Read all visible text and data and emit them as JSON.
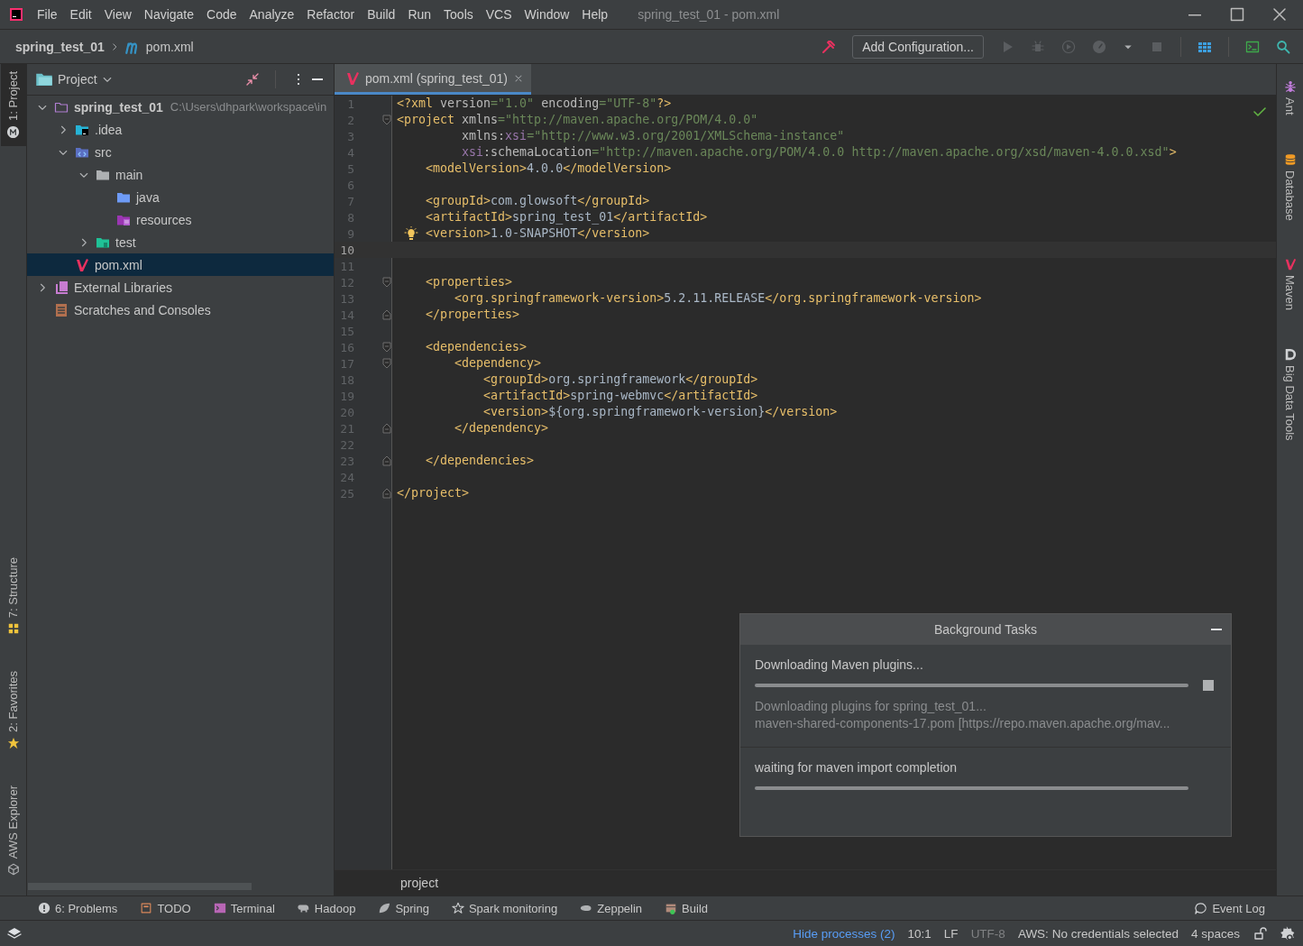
{
  "window": {
    "title": "spring_test_01 - pom.xml"
  },
  "menu": [
    "File",
    "Edit",
    "View",
    "Navigate",
    "Code",
    "Analyze",
    "Refactor",
    "Build",
    "Run",
    "Tools",
    "VCS",
    "Window",
    "Help"
  ],
  "breadcrumb": {
    "project": "spring_test_01",
    "file": "pom.xml"
  },
  "toolbar": {
    "run_configuration": "Add Configuration..."
  },
  "left_strip": {
    "top": [
      {
        "label": "1: Project",
        "kind": "project",
        "selected": true
      }
    ],
    "bottom": [
      {
        "label": "7: Structure",
        "kind": "structure",
        "selected": false
      },
      {
        "label": "2: Favorites",
        "kind": "favorites",
        "selected": false
      },
      {
        "label": "AWS Explorer",
        "kind": "aws",
        "selected": false
      }
    ]
  },
  "right_strip": [
    {
      "label": "Ant",
      "kind": "ant"
    },
    {
      "label": "Database",
      "kind": "database"
    },
    {
      "label": "Maven",
      "kind": "maven"
    },
    {
      "label": "Big Data Tools",
      "kind": "bigdata"
    }
  ],
  "project_panel": {
    "title": "Project",
    "tree": [
      {
        "label": "spring_test_01",
        "kind": "module",
        "path": "C:\\Users\\dhpark\\workspace\\in",
        "expanded": true,
        "selected": false,
        "children": [
          {
            "label": ".idea",
            "kind": "idea",
            "expanded": false,
            "selected": false
          },
          {
            "label": "src",
            "kind": "sources",
            "expanded": true,
            "selected": false,
            "children": [
              {
                "label": "main",
                "kind": "folder",
                "expanded": true,
                "selected": false,
                "children": [
                  {
                    "label": "java",
                    "kind": "java",
                    "selected": false
                  },
                  {
                    "label": "resources",
                    "kind": "resources",
                    "selected": false
                  }
                ]
              },
              {
                "label": "test",
                "kind": "tests",
                "expanded": false,
                "selected": false
              }
            ]
          },
          {
            "label": "pom.xml",
            "kind": "maven",
            "selected": true
          }
        ]
      },
      {
        "label": "External Libraries",
        "kind": "library",
        "expanded": false,
        "selected": false
      },
      {
        "label": "Scratches and Consoles",
        "kind": "scratches",
        "selected": false
      }
    ]
  },
  "editor": {
    "tabs": [
      {
        "label": "pom.xml (spring_test_01)",
        "selected": true
      }
    ],
    "lines": [
      {
        "number": "1",
        "kind": "plain",
        "selected": false,
        "intention": false,
        "tokens": [
          {
            "kind": "tag",
            "text": "<?xml "
          },
          {
            "kind": "attr",
            "text": "version"
          },
          {
            "kind": "str",
            "text": "=\"1.0\""
          },
          {
            "kind": "attr",
            "text": " encoding"
          },
          {
            "kind": "str",
            "text": "=\"UTF-8\""
          },
          {
            "kind": "tag",
            "text": "?>"
          }
        ]
      },
      {
        "number": "2",
        "kind": "opener",
        "selected": false,
        "intention": false,
        "tokens": [
          {
            "kind": "tag",
            "text": "<project "
          },
          {
            "kind": "attr",
            "text": "xmlns"
          },
          {
            "kind": "str",
            "text": "=\"http://maven.apache.org/POM/4.0.0\""
          }
        ]
      },
      {
        "number": "3",
        "kind": "plain",
        "selected": false,
        "intention": false,
        "tokens": [
          {
            "kind": "attr",
            "text": "         xmlns:"
          },
          {
            "kind": "ns",
            "text": "xsi"
          },
          {
            "kind": "str",
            "text": "=\"http://www.w3.org/2001/XMLSchema-instance\""
          }
        ]
      },
      {
        "number": "4",
        "kind": "plain",
        "selected": false,
        "intention": false,
        "tokens": [
          {
            "kind": "ns",
            "text": "         xsi"
          },
          {
            "kind": "attr",
            "text": ":schemaLocation"
          },
          {
            "kind": "str",
            "text": "=\"http://maven.apache.org/POM/4.0.0 http://maven.apache.org/xsd/maven-4.0.0.xsd\""
          },
          {
            "kind": "tag",
            "text": ">"
          }
        ]
      },
      {
        "number": "5",
        "kind": "plain",
        "selected": false,
        "intention": false,
        "tokens": [
          {
            "kind": "tag",
            "text": "    <modelVersion>"
          },
          {
            "kind": "text",
            "text": "4.0.0"
          },
          {
            "kind": "tag",
            "text": "</modelVersion>"
          }
        ]
      },
      {
        "number": "6",
        "kind": "plain",
        "selected": false,
        "intention": false
      },
      {
        "number": "7",
        "kind": "plain",
        "selected": false,
        "intention": false,
        "tokens": [
          {
            "kind": "tag",
            "text": "    <groupId>"
          },
          {
            "kind": "text",
            "text": "com.glowsoft"
          },
          {
            "kind": "tag",
            "text": "</groupId>"
          }
        ]
      },
      {
        "number": "8",
        "kind": "plain",
        "selected": false,
        "intention": false,
        "tokens": [
          {
            "kind": "tag",
            "text": "    <artifactId>"
          },
          {
            "kind": "text",
            "text": "spring_test_01"
          },
          {
            "kind": "tag",
            "text": "</artifactId>"
          }
        ]
      },
      {
        "number": "9",
        "kind": "plain",
        "selected": false,
        "intention": true,
        "tokens": [
          {
            "kind": "tag",
            "text": "    <version>"
          },
          {
            "kind": "text",
            "text": "1.0-SNAPSHOT"
          },
          {
            "kind": "tag",
            "text": "</version>"
          }
        ]
      },
      {
        "number": "10",
        "kind": "plain",
        "selected": true,
        "intention": false
      },
      {
        "number": "11",
        "kind": "plain",
        "selected": false,
        "intention": false
      },
      {
        "number": "12",
        "kind": "opener",
        "selected": false,
        "intention": false,
        "tokens": [
          {
            "kind": "tag",
            "text": "    <properties>"
          }
        ]
      },
      {
        "number": "13",
        "kind": "plain",
        "selected": false,
        "intention": false,
        "tokens": [
          {
            "kind": "tag",
            "text": "        <org.springframework-version>"
          },
          {
            "kind": "text",
            "text": "5.2.11.RELEASE"
          },
          {
            "kind": "tag",
            "text": "</org.springframework-version>"
          }
        ]
      },
      {
        "number": "14",
        "kind": "closer",
        "selected": false,
        "intention": false,
        "tokens": [
          {
            "kind": "tag",
            "text": "    </properties>"
          }
        ]
      },
      {
        "number": "15",
        "kind": "plain",
        "selected": false,
        "intention": false
      },
      {
        "number": "16",
        "kind": "opener",
        "selected": false,
        "intention": false,
        "tokens": [
          {
            "kind": "tag",
            "text": "    <dependencies>"
          }
        ]
      },
      {
        "number": "17",
        "kind": "opener",
        "selected": false,
        "intention": false,
        "tokens": [
          {
            "kind": "tag",
            "text": "        <dependency>"
          }
        ]
      },
      {
        "number": "18",
        "kind": "plain",
        "selected": false,
        "intention": false,
        "tokens": [
          {
            "kind": "tag",
            "text": "            <groupId>"
          },
          {
            "kind": "text",
            "text": "org.springframework"
          },
          {
            "kind": "tag",
            "text": "</groupId>"
          }
        ]
      },
      {
        "number": "19",
        "kind": "plain",
        "selected": false,
        "intention": false,
        "tokens": [
          {
            "kind": "tag",
            "text": "            <artifactId>"
          },
          {
            "kind": "text",
            "text": "spring-webmvc"
          },
          {
            "kind": "tag",
            "text": "</artifactId>"
          }
        ]
      },
      {
        "number": "20",
        "kind": "plain",
        "selected": false,
        "intention": false,
        "tokens": [
          {
            "kind": "tag",
            "text": "            <version>"
          },
          {
            "kind": "text",
            "text": "${org.springframework-version}"
          },
          {
            "kind": "tag",
            "text": "</version>"
          }
        ]
      },
      {
        "number": "21",
        "kind": "closer",
        "selected": false,
        "intention": false,
        "tokens": [
          {
            "kind": "tag",
            "text": "        </dependency>"
          }
        ]
      },
      {
        "number": "22",
        "kind": "plain",
        "selected": false,
        "intention": false
      },
      {
        "number": "23",
        "kind": "closer",
        "selected": false,
        "intention": false,
        "tokens": [
          {
            "kind": "tag",
            "text": "    </dependencies>"
          }
        ]
      },
      {
        "number": "24",
        "kind": "plain",
        "selected": false,
        "intention": false
      },
      {
        "number": "25",
        "kind": "closer",
        "selected": false,
        "intention": false,
        "tokens": [
          {
            "kind": "tag",
            "text": "</project>"
          }
        ]
      }
    ],
    "breadcrumb": "project"
  },
  "background_tasks": {
    "title": "Background Tasks",
    "tasks": [
      {
        "title": "Downloading Maven plugins...",
        "kind": "cancellable",
        "level": 1,
        "details": [
          "Downloading plugins for spring_test_01...",
          "maven-shared-components-17.pom [https://repo.maven.apache.org/mav..."
        ]
      },
      {
        "title": "waiting for maven import completion",
        "kind": "plain",
        "level": 1
      }
    ]
  },
  "tool_windows": {
    "left": [
      {
        "label": "6: Problems",
        "kind": "problems"
      },
      {
        "label": "TODO",
        "kind": "todo"
      },
      {
        "label": "Terminal",
        "kind": "terminal"
      },
      {
        "label": "Hadoop",
        "kind": "hadoop"
      },
      {
        "label": "Spring",
        "kind": "spring"
      },
      {
        "label": "Spark monitoring",
        "kind": "spark"
      },
      {
        "label": "Zeppelin",
        "kind": "zeppelin"
      },
      {
        "label": "Build",
        "kind": "build"
      }
    ],
    "right": [
      {
        "label": "Event Log",
        "kind": "eventlog"
      }
    ]
  },
  "status_bar": {
    "processes": "Hide processes (2)",
    "position": "10:1",
    "line_separator": "LF",
    "encoding": "UTF-8",
    "aws": "AWS: No credentials selected",
    "indent": "4 spaces"
  }
}
